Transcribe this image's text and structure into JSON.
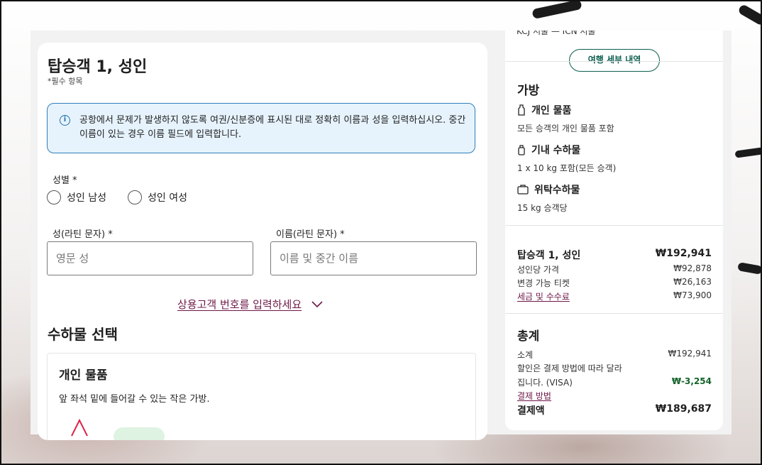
{
  "passenger_form": {
    "title": "탑승객 1, 성인",
    "required_note": "*필수 항목",
    "info_message": "공항에서 문제가 발생하지 않도록 여권/신분증에 표시된 대로 정확히 이름과 성을 입력하십시오. 중간 이름이 있는 경우 이름 필드에 입력합니다.",
    "gender_label": "성별 *",
    "gender_options": [
      "성인 남성",
      "성인 여성"
    ],
    "last_name_label": "성(라틴 문자) *",
    "last_name_placeholder": "영문 성",
    "last_name_value": "",
    "first_name_label": "이름(라틴 문자) *",
    "first_name_placeholder": "이름 및 중간 이름",
    "first_name_value": "",
    "frequent_flyer_link": "상용고객 번호를 입력하세요"
  },
  "baggage_selection": {
    "title": "수하물 선택",
    "card_title": "개인 물품",
    "card_description": "앞 좌석 밑에 들어갈 수 있는 작은 가방."
  },
  "summary": {
    "route_partial": "KCJ 서울 — ICN 서울",
    "trip_details_button": "여행 세부 내역",
    "baggage_title": "가방",
    "baggage": [
      {
        "icon": "personal-item-icon",
        "title": "개인 물품",
        "detail": "모든 승객의 개인 물품 포함"
      },
      {
        "icon": "carry-on-icon",
        "title": "기내 수하물",
        "detail": "1 x 10 kg 포함(모든 승객)"
      },
      {
        "icon": "checked-bag-icon",
        "title": "위탁수하물",
        "detail": "15 kg 승객당"
      }
    ],
    "passenger_price": {
      "label": "탑승객 1, 성인",
      "total": "₩192,941",
      "rows": [
        {
          "label": "성인당 가격",
          "value": "₩92,878"
        },
        {
          "label": "변경 가능 티켓",
          "value": "₩26,163"
        },
        {
          "label": "세금 및 수수료",
          "value": "₩73,900"
        }
      ]
    },
    "totals": {
      "title": "총계",
      "subtotal_label": "소계",
      "subtotal_value": "₩192,941",
      "discount_label_line1": "할인은 결제 방법에 따라 달라",
      "discount_label_line2": "집니다. (VISA)",
      "discount_value": "₩-3,254",
      "payment_method_link": "결제 방법",
      "grand_total_label": "결제액",
      "grand_total_value": "₩189,687"
    }
  },
  "colors": {
    "accent_maroon": "#6d1848",
    "accent_green": "#0b5e4f",
    "info_border": "#2f7fb8",
    "info_bg": "#e6f3fd",
    "discount_green": "#14632b"
  }
}
